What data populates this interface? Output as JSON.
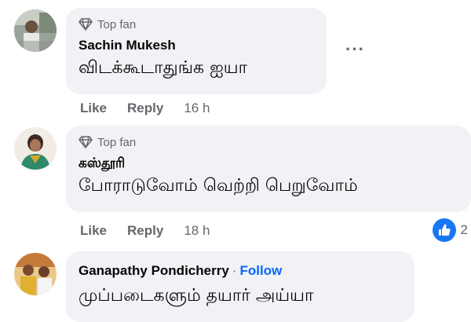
{
  "comments": [
    {
      "badge": "Top fan",
      "author": "Sachin Mukesh",
      "text": "விடக்கூடாதுங்க ஐயா",
      "actions": {
        "like": "Like",
        "reply": "Reply",
        "time": "16 h"
      },
      "more": "···"
    },
    {
      "badge": "Top fan",
      "author": "கஸ்தூரி",
      "text": "போராடுவோம் வெற்றி பெறுவோம்",
      "actions": {
        "like": "Like",
        "reply": "Reply",
        "time": "18 h"
      },
      "reaction_count": "2"
    },
    {
      "author": "Ganapathy Pondicherry",
      "separator": "·",
      "follow": "Follow",
      "text": "முப்படைகளும் தயார் அய்யா"
    }
  ],
  "colors": {
    "bubble": "#f0f2f5",
    "link": "#0866ff",
    "meta": "#65676b",
    "like": "#1877f2"
  }
}
